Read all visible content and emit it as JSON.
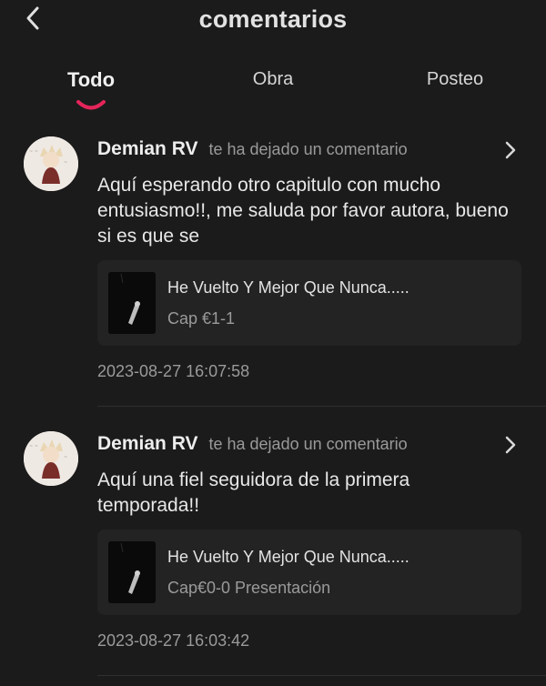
{
  "header": {
    "title": "comentarios",
    "back_icon": "chevron-left-icon"
  },
  "tabs": [
    {
      "label": "Todo",
      "active": true
    },
    {
      "label": "Obra",
      "active": false
    },
    {
      "label": "Posteo",
      "active": false
    }
  ],
  "colors": {
    "background": "#1b1b1b",
    "card": "#232323",
    "accent": "#e5255a",
    "muted_text": "#9a9a9a"
  },
  "comments": [
    {
      "user": "Demian RV",
      "action": "te ha dejado un comentario",
      "text": "Aquí esperando otro capitulo con mucho entusiasmo!!, me saluda por favor autora, bueno si es que se",
      "work": {
        "title": "He Vuelto Y Mejor Que Nunca.....",
        "chapter": "Cap €1-1"
      },
      "date": "2023-08-27 16:07:58"
    },
    {
      "user": "Demian RV",
      "action": "te ha dejado un comentario",
      "text": "Aquí una fiel seguidora de la primera temporada!!",
      "work": {
        "title": "He Vuelto Y Mejor Que Nunca.....",
        "chapter": "Cap€0-0 Presentación"
      },
      "date": "2023-08-27 16:03:42"
    }
  ]
}
